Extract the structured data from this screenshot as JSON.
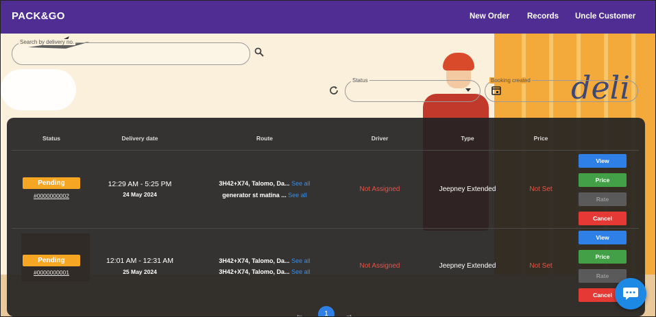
{
  "navbar": {
    "brand": "PACK&GO",
    "links": [
      "New Order",
      "Records",
      "Uncle Customer"
    ]
  },
  "search": {
    "label": "Search by delivery no.",
    "value": ""
  },
  "filters": {
    "status_label": "Status",
    "status_value": "",
    "booking_label": "Booking created"
  },
  "background": {
    "sign_text": "deli"
  },
  "table": {
    "headers": [
      "Status",
      "Delivery date",
      "Route",
      "Driver",
      "Type",
      "Price"
    ],
    "rows": [
      {
        "status": "Pending",
        "order_no": "#0000000002",
        "time": "12:29 AM - 5:25 PM",
        "date": "24 May 2024",
        "route_1": "3H42+X74, Talomo, Da...",
        "route_2": "generator st matina ...",
        "see_all": "See all",
        "driver": "Not Assigned",
        "type": "Jeepney Extended",
        "price": "Not Set",
        "actions": [
          "View",
          "Price",
          "Rate",
          "Cancel"
        ]
      },
      {
        "status": "Pending",
        "order_no": "#0000000001",
        "time": "12:01 AM - 12:31 AM",
        "date": "25 May 2024",
        "route_1": "3H42+X74, Talomo, Da...",
        "route_2": "3H42+X74, Talomo, Da...",
        "see_all": "See all",
        "driver": "Not Assigned",
        "type": "Jeepney Extended",
        "price": "Not Set",
        "actions": [
          "View",
          "Price",
          "Rate",
          "Cancel"
        ]
      }
    ]
  },
  "pagination": {
    "prev": "←",
    "current": "1",
    "next": "→"
  },
  "icons": {
    "search": "search-icon",
    "refresh": "refresh-icon",
    "calendar": "calendar-icon",
    "chat": "chat-icon"
  },
  "colors": {
    "navbar": "#4f2d93",
    "pending": "#f5a623",
    "view": "#2f80e6",
    "price": "#43a047",
    "cancel": "#e53935",
    "not_assigned": "#e0584a"
  }
}
